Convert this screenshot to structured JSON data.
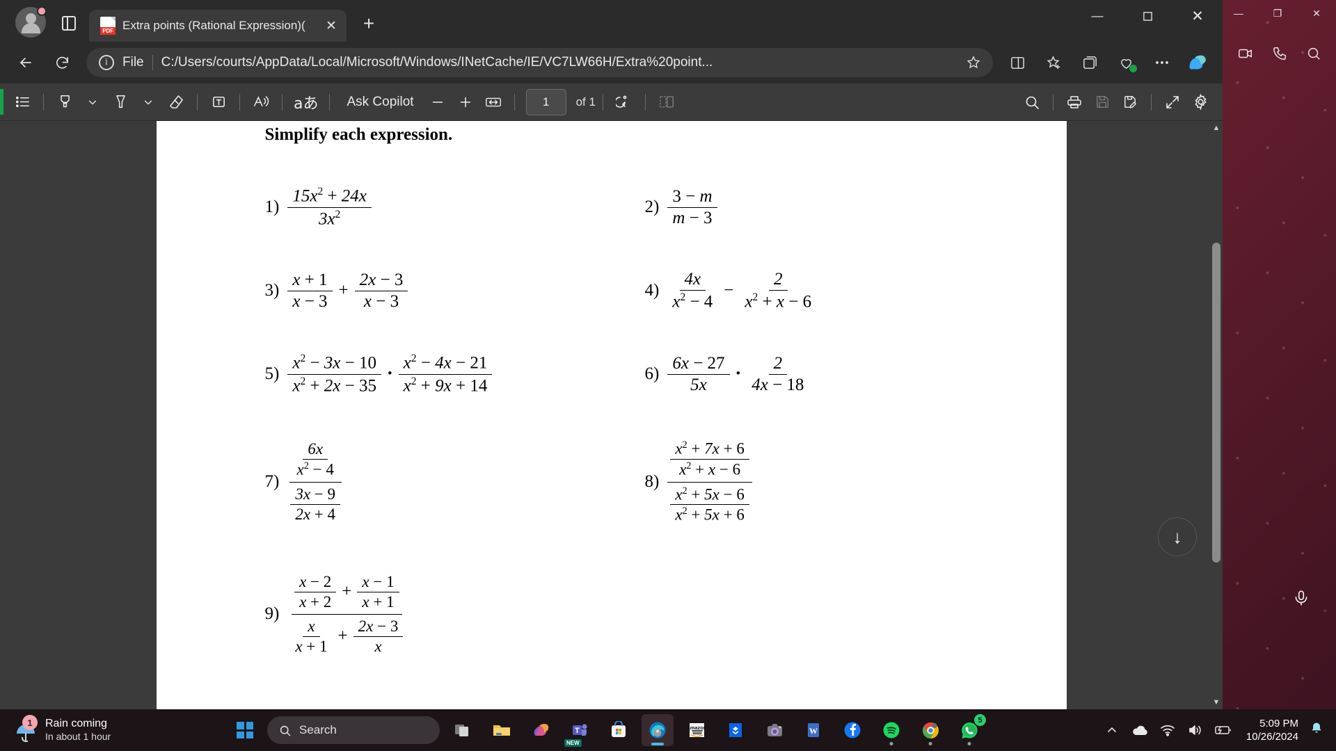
{
  "browser": {
    "tab": {
      "title": "Extra points (Rational Expression)(",
      "favicon_label": "PDF",
      "favicon_name": "pdf-file-icon",
      "close_label": "✕"
    },
    "new_tab_label": "+",
    "window_controls": {
      "minimize": "—",
      "maximize": "☐",
      "close": "✕"
    },
    "address": {
      "scheme_label": "File",
      "url": "C:/Users/courts/AppData/Local/Microsoft/Windows/INetCache/IE/VC7LW66H/Extra%20point...",
      "info_icon": "i"
    },
    "os_controls": {
      "minimize": "—",
      "restore": "❐",
      "close": "✕"
    }
  },
  "pdf_toolbar": {
    "ask_copilot_label": "Ask Copilot",
    "zoom_out_label": "—",
    "zoom_in_label": "+",
    "page_number_value": "1",
    "page_count_label": "of 1",
    "icons": {
      "toc": "table-of-contents-icon",
      "highlight": "highlighter-icon",
      "highlight_caret": "chevron-down-icon",
      "pen": "pen-icon",
      "pen_caret": "chevron-down-icon",
      "eraser": "eraser-icon",
      "text_box": "add-text-icon",
      "read_aloud": "read-aloud-icon",
      "translate": "translate-icon",
      "fit_page": "fit-to-width-icon",
      "rotate": "rotate-icon",
      "page_view": "page-view-icon",
      "search": "search-icon",
      "print": "print-icon",
      "save": "save-icon",
      "save_as": "save-as-icon",
      "fullscreen": "fullscreen-icon",
      "settings": "gear-icon"
    }
  },
  "document": {
    "title": "Simplify each expression.",
    "problems": [
      {
        "number": "1)",
        "kind": "simple_fraction",
        "numerator": "15x² + 24x",
        "denominator": "3x²",
        "latex": "(15x^2 + 24x) / (3x^2)"
      },
      {
        "number": "2)",
        "kind": "simple_fraction",
        "numerator": "3 − m",
        "denominator": "m − 3",
        "latex": "(3 - m) / (m - 3)"
      },
      {
        "number": "3)",
        "kind": "sum_of_fractions",
        "operator": "+",
        "left_numerator": "x + 1",
        "left_denominator": "x − 3",
        "right_numerator": "2x − 3",
        "right_denominator": "x − 3",
        "latex": "(x+1)/(x-3) + (2x-3)/(x-3)"
      },
      {
        "number": "4)",
        "kind": "difference_of_fractions",
        "operator": "−",
        "left_numerator": "4x",
        "left_denominator": "x² − 4",
        "right_numerator": "2",
        "right_denominator": "x² + x − 6",
        "latex": "4x/(x^2-4) - 2/(x^2+x-6)"
      },
      {
        "number": "5)",
        "kind": "product_of_fractions",
        "operator": "•",
        "left_numerator": "x² − 3x − 10",
        "left_denominator": "x² + 2x − 35",
        "right_numerator": "x² − 4x − 21",
        "right_denominator": "x² + 9x + 14",
        "latex": "(x^2-3x-10)/(x^2+2x-35) * (x^2-4x-21)/(x^2+9x+14)"
      },
      {
        "number": "6)",
        "kind": "product_of_fractions",
        "operator": "•",
        "left_numerator": "6x − 27",
        "left_denominator": "5x",
        "right_numerator": "2",
        "right_denominator": "4x − 18",
        "latex": "(6x-27)/(5x) * 2/(4x-18)"
      },
      {
        "number": "7)",
        "kind": "complex_fraction",
        "top_numerator": "6x",
        "top_denominator": "x² − 4",
        "bottom_numerator": "3x − 9",
        "bottom_denominator": "2x + 4",
        "latex": "[6x/(x^2-4)] / [(3x-9)/(2x+4)]"
      },
      {
        "number": "8)",
        "kind": "complex_fraction",
        "top_numerator": "x² + 7x + 6",
        "top_denominator": "x² + x − 6",
        "bottom_numerator": "x² + 5x − 6",
        "bottom_denominator": "x² + 5x + 6",
        "latex": "[(x^2+7x+6)/(x^2+x-6)] / [(x^2+5x-6)/(x^2+5x+6)]"
      },
      {
        "number": "9)",
        "kind": "complex_fraction_sums",
        "top_left_numerator": "x − 2",
        "top_left_denominator": "x + 2",
        "top_operator": "+",
        "top_right_numerator": "x − 1",
        "top_right_denominator": "x + 1",
        "bottom_left_numerator": "x",
        "bottom_left_denominator": "x + 1",
        "bottom_operator": "+",
        "bottom_right_numerator": "2x − 3",
        "bottom_right_denominator": "x",
        "latex": "[(x-2)/(x+2) + (x-1)/(x+1)] / [x/(x+1) + (2x-3)/x]"
      }
    ]
  },
  "viewer": {
    "scroll_down_label": "↓",
    "scroll_up_arrow": "▲",
    "scroll_down_arrow": "▼"
  },
  "taskbar": {
    "weather": {
      "title": "Rain coming",
      "subtitle": "In about 1 hour",
      "badge": "1",
      "icon": "umbrella-rain-icon"
    },
    "search_placeholder": "Search",
    "apps": [
      {
        "name": "task-view",
        "label": "Task View"
      },
      {
        "name": "file-explorer",
        "label": "File Explorer"
      },
      {
        "name": "copilot",
        "label": "Copilot"
      },
      {
        "name": "microsoft-teams",
        "label": "Microsoft Teams",
        "badge": "NEW"
      },
      {
        "name": "microsoft-store",
        "label": "Microsoft Store"
      },
      {
        "name": "microsoft-edge",
        "label": "Microsoft Edge",
        "active": true
      },
      {
        "name": "amazon",
        "label": "Amazon"
      },
      {
        "name": "dropbox",
        "label": "Dropbox"
      },
      {
        "name": "camera",
        "label": "Camera"
      },
      {
        "name": "microsoft-word",
        "label": "Word"
      },
      {
        "name": "facebook",
        "label": "Facebook"
      },
      {
        "name": "spotify",
        "label": "Spotify"
      },
      {
        "name": "google-chrome",
        "label": "Google Chrome"
      },
      {
        "name": "whatsapp",
        "label": "WhatsApp",
        "badge": "5"
      }
    ],
    "tray": {
      "overflow": "^",
      "onedrive": "onedrive-icon",
      "wifi": "wifi-icon",
      "volume": "volume-icon",
      "battery": "battery-icon",
      "time": "5:09 PM",
      "date": "10/26/2024",
      "bell": "🔔"
    }
  }
}
